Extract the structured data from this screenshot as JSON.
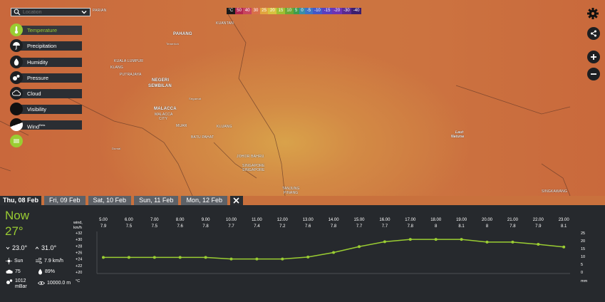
{
  "search": {
    "placeholder": "Location"
  },
  "layers": [
    {
      "label": "Temperature",
      "icon": "thermometer-icon",
      "active": true
    },
    {
      "label": "Precipitation",
      "icon": "umbrella-icon"
    },
    {
      "label": "Humidity",
      "icon": "water-drop-icon"
    },
    {
      "label": "Pressure",
      "icon": "pressure-icon"
    },
    {
      "label": "Cloud",
      "icon": "cloud-icon"
    },
    {
      "label": "Visibility",
      "icon": "visibility-icon"
    },
    {
      "label": "Wind",
      "badge": "Beta",
      "icon": "wind-icon"
    },
    {
      "label": "",
      "icon": "extra-layer-icon"
    }
  ],
  "legend": {
    "unit": "°C",
    "values": [
      "50",
      "40",
      "30",
      "25",
      "20",
      "15",
      "10",
      "5",
      "0",
      "-5",
      "-10",
      "-15",
      "-20",
      "-30",
      "-40"
    ],
    "colors": [
      "#b2264e",
      "#c8455f",
      "#d9704a",
      "#e1a53e",
      "#d8c240",
      "#9fbf33",
      "#6aa835",
      "#3f9e4c",
      "#3a8fa8",
      "#3f74c4",
      "#4558c8",
      "#5a3fbf",
      "#6d34b3",
      "#5a2a90",
      "#3c1e6e"
    ]
  },
  "map_labels": [
    {
      "text": "PARIAN"
    },
    {
      "text": "KUANTAN"
    },
    {
      "text": "PAHANG"
    },
    {
      "text": "Temerloh"
    },
    {
      "text": "KUALA LUMPUR"
    },
    {
      "text": "KLANG"
    },
    {
      "text": "PUTRAJAYA"
    },
    {
      "text": "NEGERI"
    },
    {
      "text": "SEMBILAN"
    },
    {
      "text": "Segamat"
    },
    {
      "text": "MALACCA"
    },
    {
      "text": "MALACCA"
    },
    {
      "text": "CITY"
    },
    {
      "text": "MUAR"
    },
    {
      "text": "BATU PAHAT"
    },
    {
      "text": "KLUANG"
    },
    {
      "text": "Dumai"
    },
    {
      "text": "JOHOR BAHRU"
    },
    {
      "text": "SINGAPORE"
    },
    {
      "text": "SINGAPORE"
    },
    {
      "text": "Laut"
    },
    {
      "text": "Natuna"
    },
    {
      "text": "TANJUNG"
    },
    {
      "text": "PINANG"
    },
    {
      "text": "SINGKAWANG"
    }
  ],
  "tabs": [
    "Thu, 08 Feb",
    "Fri, 09 Feb",
    "Sat, 10 Feb",
    "Sun, 11 Feb",
    "Mon, 12 Feb"
  ],
  "current": {
    "now_label": "Now",
    "temp": "27°",
    "min": "23.0°",
    "max": "31.0°",
    "condition": "Sun",
    "wind": "7.9 km/h",
    "cloud": "75",
    "humidity": "89%",
    "pressure_value": "1012",
    "pressure_unit": "mBar",
    "visibility": "10000.0 m"
  },
  "chart_data": {
    "type": "line",
    "hours": [
      "5.00",
      "6.00",
      "7.00",
      "8.00",
      "9.00",
      "10.00",
      "11.00",
      "12.00",
      "13.00",
      "14.00",
      "15.00",
      "16.00",
      "17.00",
      "18.00",
      "19.00",
      "20.00",
      "21.00",
      "22.00",
      "23.00"
    ],
    "wind": [
      "7.9",
      "7.5",
      "7.5",
      "7.6",
      "7.8",
      "7.7",
      "7.4",
      "7.2",
      "7.6",
      "7.8",
      "7.7",
      "7.7",
      "7.8",
      "8",
      "8.1",
      "8",
      "7.8",
      "7.9",
      "8.1"
    ],
    "highlight_index": 17,
    "temperature": [
      24.5,
      24.5,
      24.5,
      24.5,
      24.5,
      24,
      24,
      24,
      24.6,
      26,
      27.8,
      29.3,
      30,
      30,
      30,
      29.2,
      29.2,
      28.5,
      27.7
    ],
    "left_axis_header": [
      "wind,",
      "km/h"
    ],
    "left_axis_unit": "°C",
    "left_ticks": [
      "+32",
      "+30",
      "+28",
      "+26",
      "+24",
      "+22",
      "+20"
    ],
    "left_tick_values": [
      32,
      30,
      28,
      26,
      24,
      22,
      20
    ],
    "right_ticks": [
      "25",
      "20",
      "15",
      "10",
      "5",
      "0"
    ],
    "right_unit": "mm",
    "ylim": [
      20,
      32
    ],
    "series_color": "#9acd32"
  }
}
